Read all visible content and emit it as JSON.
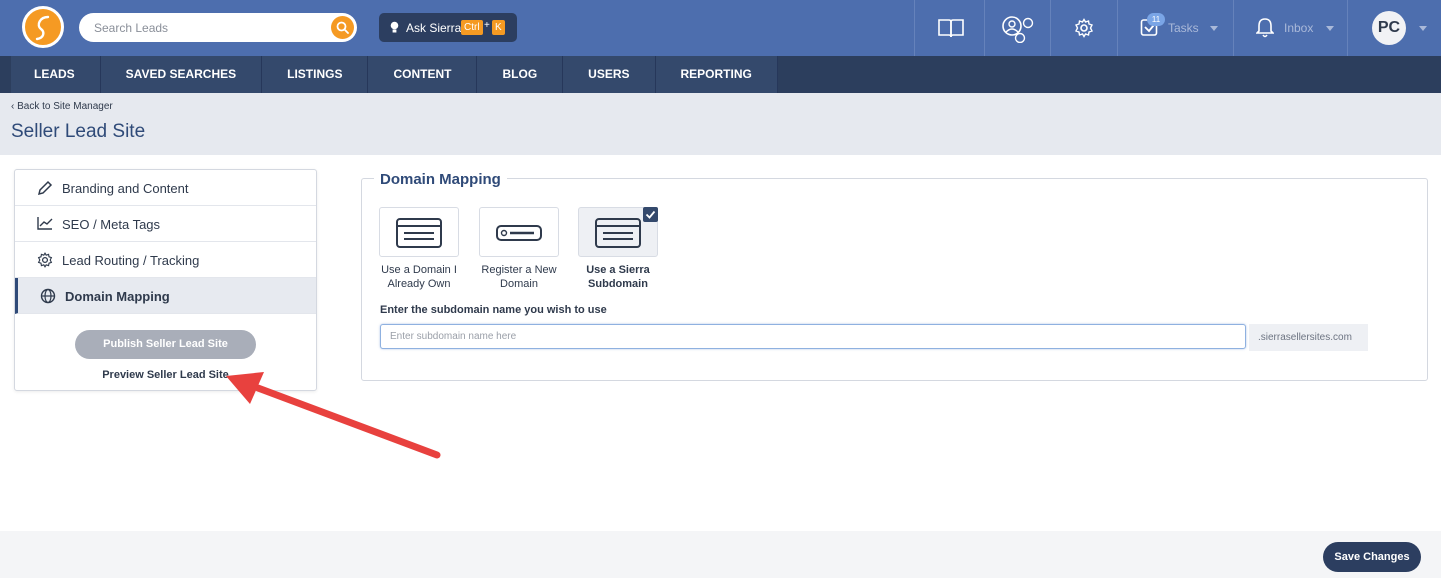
{
  "header": {
    "search": {
      "placeholder": "Search Leads",
      "value": ""
    },
    "ask": {
      "label": "Ask Sierra",
      "shortcut_ctrl": "Ctrl",
      "shortcut_plus": "+",
      "shortcut_key": "K"
    },
    "tasks": {
      "label": "Tasks",
      "badge": "11"
    },
    "inbox": {
      "label": "Inbox"
    },
    "avatar": "PC",
    "icons": [
      "book-icon",
      "people-network-icon",
      "gear-icon",
      "tasks-check-icon",
      "bell-icon"
    ]
  },
  "nav": {
    "items": [
      {
        "label": "LEADS"
      },
      {
        "label": "SAVED SEARCHES"
      },
      {
        "label": "LISTINGS"
      },
      {
        "label": "CONTENT"
      },
      {
        "label": "BLOG"
      },
      {
        "label": "USERS"
      },
      {
        "label": "REPORTING"
      }
    ]
  },
  "page": {
    "back_link": "‹ Back to Site Manager",
    "title": "Seller Lead Site"
  },
  "menu": {
    "items": [
      {
        "label": "Branding and Content",
        "icon": "pencil-icon",
        "active": false
      },
      {
        "label": "SEO / Meta Tags",
        "icon": "chart-line-icon",
        "active": false
      },
      {
        "label": "Lead Routing / Tracking",
        "icon": "gear-icon",
        "active": false
      },
      {
        "label": "Domain Mapping",
        "icon": "globe-icon",
        "active": true
      }
    ],
    "publish_label": "Publish Seller Lead Site",
    "preview_label": "Preview Seller Lead Site"
  },
  "domain": {
    "title": "Domain Mapping",
    "options": [
      {
        "label": "Use a Domain I Already Own",
        "selected": false
      },
      {
        "label": "Register a New Domain",
        "selected": false
      },
      {
        "label": "Use a Sierra Subdomain",
        "selected": true
      }
    ],
    "subdomain_label": "Enter the subdomain name you wish to use",
    "subdomain_placeholder": "Enter subdomain name here",
    "subdomain_value": "",
    "suffix": ".sierrasellersites.com"
  },
  "footer": {
    "save_label": "Save Changes"
  },
  "colors": {
    "brand_orange": "#f59a23",
    "header_blue": "#4d6eae",
    "nav_dark": "#2c3e5d",
    "annotation_red": "#e8413e"
  }
}
